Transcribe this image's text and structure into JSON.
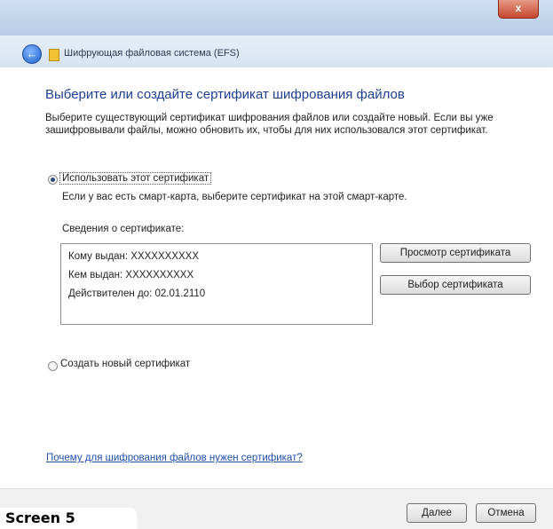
{
  "window": {
    "close_glyph": "x",
    "title": "Шифрующая файловая система (EFS)"
  },
  "page": {
    "heading": "Выберите или создайте сертификат шифрования файлов",
    "description": "Выберите существующий сертификат шифрования файлов или создайте новый. Если вы уже зашифровывали файлы, можно обновить их, чтобы для них использовался этот сертификат.",
    "option_use": {
      "label": "Использовать этот сертификат",
      "selected": true,
      "hint": "Если у вас есть смарт-карта, выберите сертификат на этой смарт-карте."
    },
    "cert_info": {
      "label": "Сведения о сертификате:",
      "issued_to": "Кому выдан: XXXXXXXXXX",
      "issued_by": "Кем выдан: XXXXXXXXXX",
      "valid_to": "Действителен до: 02.01.2110"
    },
    "buttons": {
      "view_cert": "Просмотр сертификата",
      "select_cert": "Выбор сертификата"
    },
    "option_new": {
      "label": "Создать новый сертификат",
      "selected": false
    },
    "help_link": "Почему для шифрования файлов нужен сертификат?"
  },
  "footer": {
    "next": "Далее",
    "cancel": "Отмена"
  },
  "caption": "Screen 5",
  "colors": {
    "heading": "#1c3f94",
    "link": "#1f4fa8",
    "close_button": "#c6472f"
  }
}
